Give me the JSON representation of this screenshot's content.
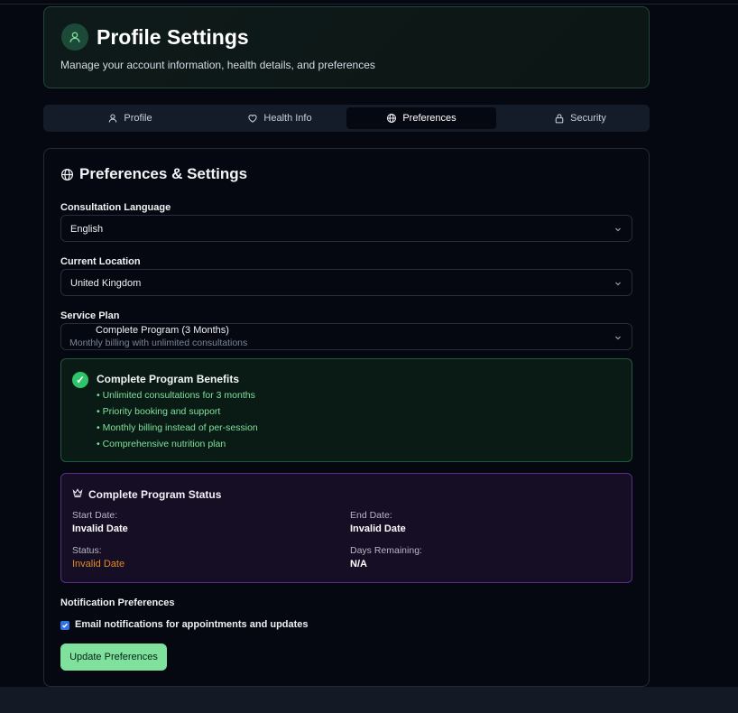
{
  "header": {
    "title": "Profile Settings",
    "subtitle": "Manage your account information, health details, and preferences"
  },
  "tabs": [
    {
      "label": "Profile",
      "icon": "user-icon",
      "active": false
    },
    {
      "label": "Health Info",
      "icon": "heart-icon",
      "active": false
    },
    {
      "label": "Preferences",
      "icon": "globe-icon",
      "active": true
    },
    {
      "label": "Security",
      "icon": "lock-icon",
      "active": false
    }
  ],
  "preferences": {
    "title": "Preferences & Settings",
    "language": {
      "label": "Consultation Language",
      "value": "English"
    },
    "location": {
      "label": "Current Location",
      "value": "United Kingdom"
    },
    "plan": {
      "label": "Service Plan",
      "value": "Complete Program (3 Months)",
      "description": "Monthly billing with unlimited consultations"
    },
    "benefits": {
      "title": "Complete Program Benefits",
      "items": [
        "• Unlimited consultations for 3 months",
        "• Priority booking and support",
        "• Monthly billing instead of per-session",
        "• Comprehensive nutrition plan"
      ]
    },
    "status": {
      "title": "Complete Program Status",
      "start_label": "Start Date:",
      "start_value": "Invalid Date",
      "end_label": "End Date:",
      "end_value": "Invalid Date",
      "status_label": "Status:",
      "status_value": "Invalid Date",
      "days_label": "Days Remaining:",
      "days_value": "N/A"
    },
    "notifications": {
      "label": "Notification Preferences",
      "email_label": "Email notifications for appointments and updates",
      "email_checked": true
    },
    "update_button": "Update Preferences"
  },
  "colors": {
    "accent_green": "#7ee29c",
    "status_purple": "#5a2d8c",
    "warning_orange": "#e08a2a"
  }
}
